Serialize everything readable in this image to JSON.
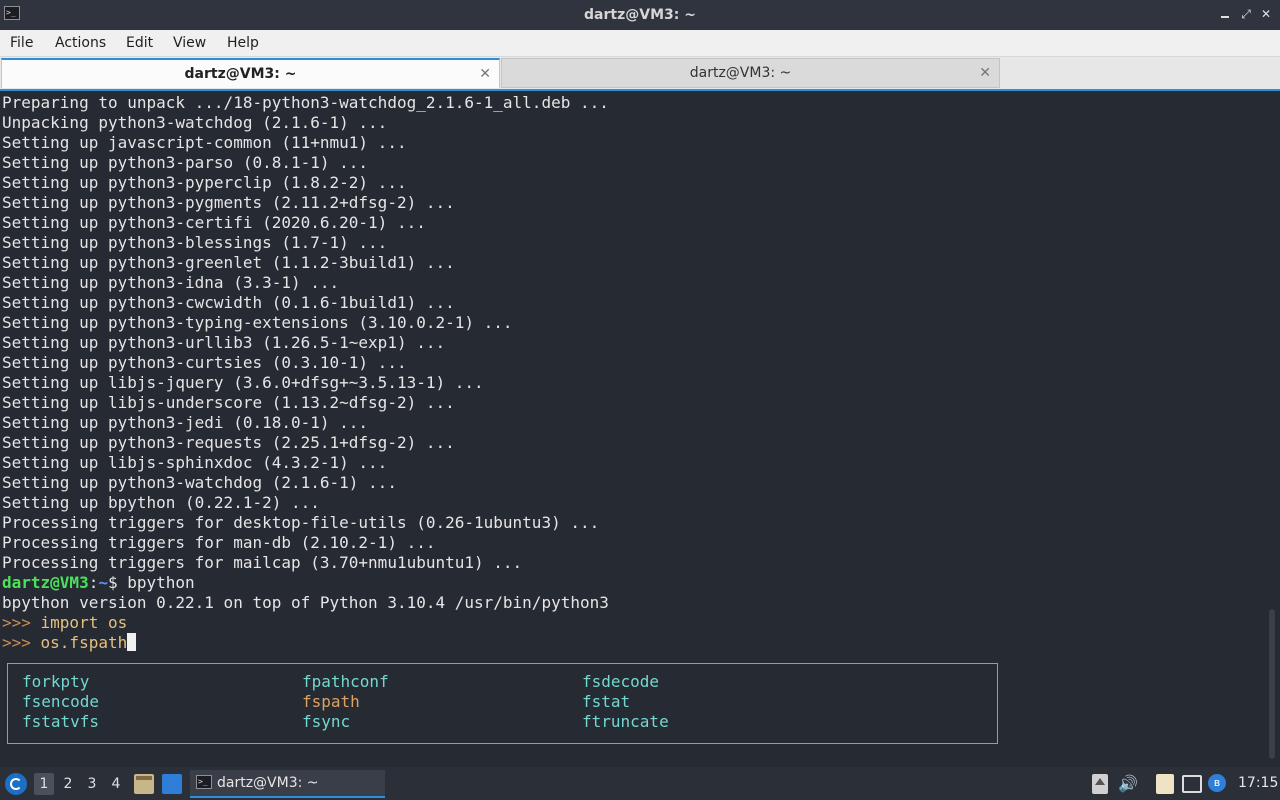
{
  "window": {
    "title": "dartz@VM3: ~",
    "app_icon_glyph": ">_"
  },
  "menu": {
    "items": [
      "File",
      "Actions",
      "Edit",
      "View",
      "Help"
    ]
  },
  "tabs": [
    {
      "label": "dartz@VM3: ~",
      "active": true
    },
    {
      "label": "dartz@VM3: ~",
      "active": false
    }
  ],
  "terminal": {
    "output_lines": [
      "Preparing to unpack .../18-python3-watchdog_2.1.6-1_all.deb ...",
      "Unpacking python3-watchdog (2.1.6-1) ...",
      "Setting up javascript-common (11+nmu1) ...",
      "Setting up python3-parso (0.8.1-1) ...",
      "Setting up python3-pyperclip (1.8.2-2) ...",
      "Setting up python3-pygments (2.11.2+dfsg-2) ...",
      "Setting up python3-certifi (2020.6.20-1) ...",
      "Setting up python3-blessings (1.7-1) ...",
      "Setting up python3-greenlet (1.1.2-3build1) ...",
      "Setting up python3-idna (3.3-1) ...",
      "Setting up python3-cwcwidth (0.1.6-1build1) ...",
      "Setting up python3-typing-extensions (3.10.0.2-1) ...",
      "Setting up python3-urllib3 (1.26.5-1~exp1) ...",
      "Setting up python3-curtsies (0.3.10-1) ...",
      "Setting up libjs-jquery (3.6.0+dfsg+~3.5.13-1) ...",
      "Setting up libjs-underscore (1.13.2~dfsg-2) ...",
      "Setting up python3-jedi (0.18.0-1) ...",
      "Setting up python3-requests (2.25.1+dfsg-2) ...",
      "Setting up libjs-sphinxdoc (4.3.2-1) ...",
      "Setting up python3-watchdog (2.1.6-1) ...",
      "Setting up bpython (0.22.1-2) ...",
      "Processing triggers for desktop-file-utils (0.26-1ubuntu3) ...",
      "Processing triggers for man-db (2.10.2-1) ...",
      "Processing triggers for mailcap (3.70+nmu1ubuntu1) ..."
    ],
    "shell_prompt": {
      "user_host": "dartz@VM3",
      "sep": ":",
      "path": "~",
      "symbol": "$ ",
      "command": "bpython"
    },
    "version_line": "bpython version 0.22.1 on top of Python 3.10.4 /usr/bin/python3",
    "py_prompt": ">>> ",
    "py_history": [
      "import os"
    ],
    "current_input": "os.fspath",
    "completions": [
      {
        "label": "forkpty",
        "selected": false
      },
      {
        "label": "fpathconf",
        "selected": false
      },
      {
        "label": "fsdecode",
        "selected": false
      },
      {
        "label": "fsencode",
        "selected": false
      },
      {
        "label": "fspath",
        "selected": true
      },
      {
        "label": "fstat",
        "selected": false
      },
      {
        "label": "fstatvfs",
        "selected": false
      },
      {
        "label": "fsync",
        "selected": false
      },
      {
        "label": "ftruncate",
        "selected": false
      }
    ]
  },
  "taskbar": {
    "workspaces": [
      "1",
      "2",
      "3",
      "4"
    ],
    "active_workspace": "1",
    "task": {
      "label": "dartz@VM3: ~"
    },
    "clock": "17:15",
    "volume_glyph": "🔊",
    "bluetooth_glyph": "ʙ"
  },
  "colors": {
    "terminal_bg": "#262a33",
    "accent": "#2b8fdc",
    "prompt_user": "#4ee05a",
    "prompt_path": "#5f8fff",
    "completion": "#74d8d0",
    "completion_selected": "#e0a260"
  },
  "icons": {
    "app": "terminal-icon",
    "minimize": "minimize-icon",
    "maximize": "maximize-icon",
    "close": "close-icon",
    "tab_close": "close-icon",
    "start": "start-menu-icon",
    "files": "file-manager-icon",
    "desktop": "show-desktop-icon",
    "update": "update-icon",
    "volume": "volume-icon",
    "clipboard": "clipboard-icon",
    "network": "network-icon",
    "bluetooth": "bluetooth-icon"
  }
}
